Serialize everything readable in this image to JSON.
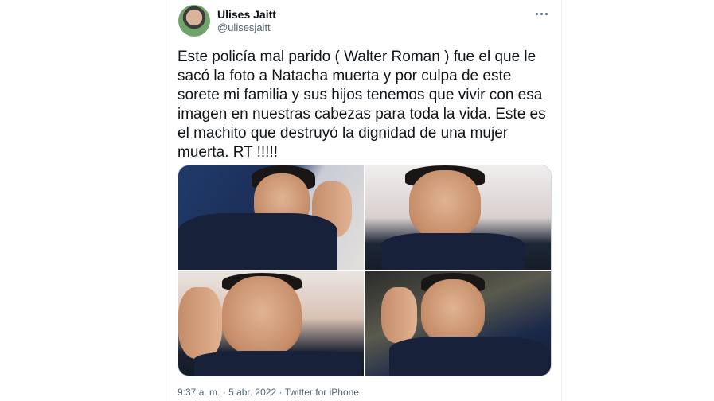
{
  "author": {
    "name": "Ulises Jaitt",
    "handle": "@ulisesjaitt"
  },
  "tweet": {
    "text": "Este policía mal parido ( Walter Roman ) fue el que le\nsacó la foto a Natacha muerta y por culpa de este\nsorete mi familia y sus hijos tenemos que vivir con esa\nimagen en nuestras cabezas para toda la vida. Este es\nel machito que destruyó la dignidad de una mujer\nmuerta. RT !!!!!",
    "time": "9:37 a. m.",
    "separator": "·",
    "date": "5 abr. 2022",
    "source": "Twitter for iPhone"
  },
  "icons": {
    "more": "more-icon"
  },
  "colors": {
    "text": "#0f1419",
    "secondary": "#536471",
    "border": "#cfd9de"
  }
}
